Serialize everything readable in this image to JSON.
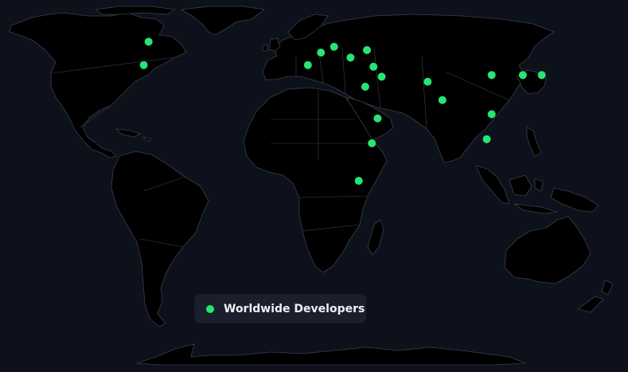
{
  "map": {
    "background_color": "#0d111b",
    "land_color": "#000000",
    "border_color": "#3a3f48",
    "marker_color": "#27e573",
    "projection": "equirectangular"
  },
  "legend": {
    "label": "Worldwide Developers",
    "marker_color": "#27e573"
  },
  "developer_locations": [
    {
      "lon": -101,
      "lat": 54
    },
    {
      "lon": -104,
      "lat": 40
    },
    {
      "lon": -4,
      "lat": 40
    },
    {
      "lon": 4,
      "lat": 47.5
    },
    {
      "lon": 12,
      "lat": 51
    },
    {
      "lon": 32,
      "lat": 49
    },
    {
      "lon": 22,
      "lat": 44.5
    },
    {
      "lon": 36,
      "lat": 39
    },
    {
      "lon": 41,
      "lat": 33
    },
    {
      "lon": 31,
      "lat": 27
    },
    {
      "lon": 69,
      "lat": 30
    },
    {
      "lon": 78,
      "lat": 19
    },
    {
      "lon": 108,
      "lat": 34
    },
    {
      "lon": 127,
      "lat": 34
    },
    {
      "lon": 138.5,
      "lat": 34
    },
    {
      "lon": 108,
      "lat": 10.5
    },
    {
      "lon": 105,
      "lat": -4.5
    },
    {
      "lon": 38.5,
      "lat": 8
    },
    {
      "lon": 35,
      "lat": -7
    },
    {
      "lon": 27,
      "lat": -29.5
    }
  ]
}
